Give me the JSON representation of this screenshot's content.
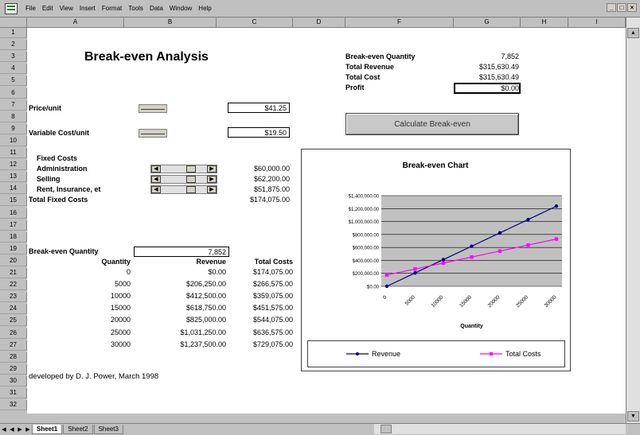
{
  "menu": [
    "File",
    "Edit",
    "View",
    "Insert",
    "Format",
    "Tools",
    "Data",
    "Window",
    "Help"
  ],
  "window_controls": [
    "_",
    "×"
  ],
  "columns": [
    "A",
    "B",
    "C",
    "D",
    "E",
    "F",
    "G",
    "H",
    "I"
  ],
  "rows": [
    "1",
    "2",
    "3",
    "4",
    "5",
    "6",
    "7",
    "8",
    "9",
    "10",
    "11",
    "12",
    "13",
    "14",
    "15",
    "16",
    "17",
    "18",
    "19",
    "20",
    "21",
    "22",
    "23",
    "24",
    "25",
    "26",
    "27",
    "28",
    "29",
    "30",
    "31",
    "32"
  ],
  "sheet": {
    "title": "Break-even Analysis",
    "price_label": "Price/unit",
    "price_value": "$41.25",
    "varcost_label": "Variable Cost/unit",
    "varcost_value": "$19.50",
    "fixed_costs_header": "Fixed Costs",
    "fixed_items": [
      {
        "label": "Administration",
        "value": "$60,000.00"
      },
      {
        "label": "Selling",
        "value": "$62,200.00"
      },
      {
        "label": "Rent, Insurance, et",
        "value": "$51,875.00"
      }
    ],
    "total_fixed_label": "Total Fixed Costs",
    "total_fixed_value": "$174,075.00",
    "beq_label": "Break-even Quantity",
    "beq_value": "7,852",
    "table_headers": [
      "Quantity",
      "Revenue",
      "Total Costs"
    ],
    "table_rows": [
      [
        "0",
        "$0.00",
        "$174,075.00"
      ],
      [
        "5000",
        "$206,250.00",
        "$266,575.00"
      ],
      [
        "10000",
        "$412,500.00",
        "$359,075.00"
      ],
      [
        "15000",
        "$618,750.00",
        "$451,575.00"
      ],
      [
        "20000",
        "$825,000.00",
        "$544,075.00"
      ],
      [
        "25000",
        "$1,031,250.00",
        "$636,575.00"
      ],
      [
        "30000",
        "$1,237,500.00",
        "$729,075.00"
      ]
    ],
    "credit": "developed by D. J. Power, March 1998"
  },
  "summary": {
    "items": [
      {
        "label": "Break-even Quantity",
        "value": "7,852"
      },
      {
        "label": "Total Revenue",
        "value": "$315,630.49"
      },
      {
        "label": "Total Cost",
        "value": "$315,630.49"
      },
      {
        "label": "Profit",
        "value": "$0.00"
      }
    ]
  },
  "button": {
    "label": "Calculate Break-even"
  },
  "tabs": [
    "Sheet1",
    "Sheet2",
    "Sheet3"
  ],
  "chart_data": {
    "type": "line",
    "title": "Break-even Chart",
    "xlabel": "Quantity",
    "ylabel": "",
    "categories": [
      "0",
      "5000",
      "10000",
      "15000",
      "20000",
      "25000",
      "30000"
    ],
    "ytick_labels": [
      "$0.00",
      "$200,000.00",
      "$400,000.00",
      "$600,000.00",
      "$800,000.00",
      "$1,000,000.00",
      "$1,200,000.00",
      "$1,400,000.00"
    ],
    "ylim": [
      0,
      1400000
    ],
    "grid": true,
    "legend": "bottom",
    "series": [
      {
        "name": "Revenue",
        "color": "#000080",
        "values": [
          0,
          206250,
          412500,
          618750,
          825000,
          1031250,
          1237500
        ]
      },
      {
        "name": "Total Costs",
        "color": "#ff00ff",
        "values": [
          174075,
          266575,
          359075,
          451575,
          544075,
          636575,
          729075
        ]
      }
    ]
  }
}
